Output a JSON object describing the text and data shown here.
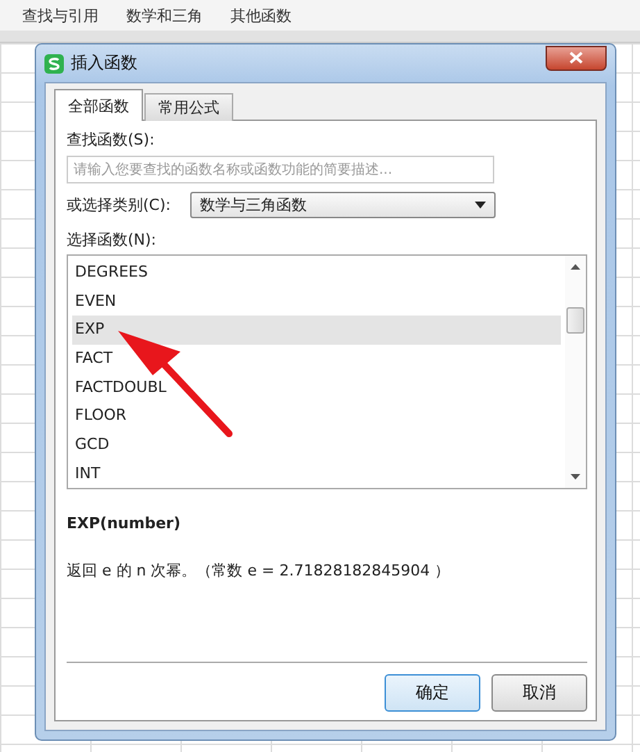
{
  "toolbar": {
    "items": [
      "查找与引用",
      "数学和三角",
      "其他函数"
    ]
  },
  "dialog": {
    "title": "插入函数",
    "tabs": [
      {
        "label": "全部函数",
        "selected": true
      },
      {
        "label": "常用公式",
        "selected": false
      }
    ],
    "search": {
      "label": "查找函数(S):",
      "placeholder": "请输入您要查找的函数名称或函数功能的简要描述..."
    },
    "category": {
      "label": "或选择类别(C):",
      "value": "数学与三角函数"
    },
    "functions": {
      "label": "选择函数(N):",
      "items": [
        {
          "name": "DEGREES",
          "selected": false
        },
        {
          "name": "EVEN",
          "selected": false
        },
        {
          "name": "EXP",
          "selected": true
        },
        {
          "name": "FACT",
          "selected": false
        },
        {
          "name": "FACTDOUBL",
          "selected": false
        },
        {
          "name": "FLOOR",
          "selected": false
        },
        {
          "name": "GCD",
          "selected": false
        },
        {
          "name": "INT",
          "selected": false
        }
      ]
    },
    "description": {
      "signature": "EXP(number)",
      "text": "返回 e 的 n 次幂。（常数 e = 2.71828182845904 ）"
    },
    "buttons": [
      {
        "label": "确定",
        "default": true
      },
      {
        "label": "取消",
        "default": false
      }
    ]
  }
}
